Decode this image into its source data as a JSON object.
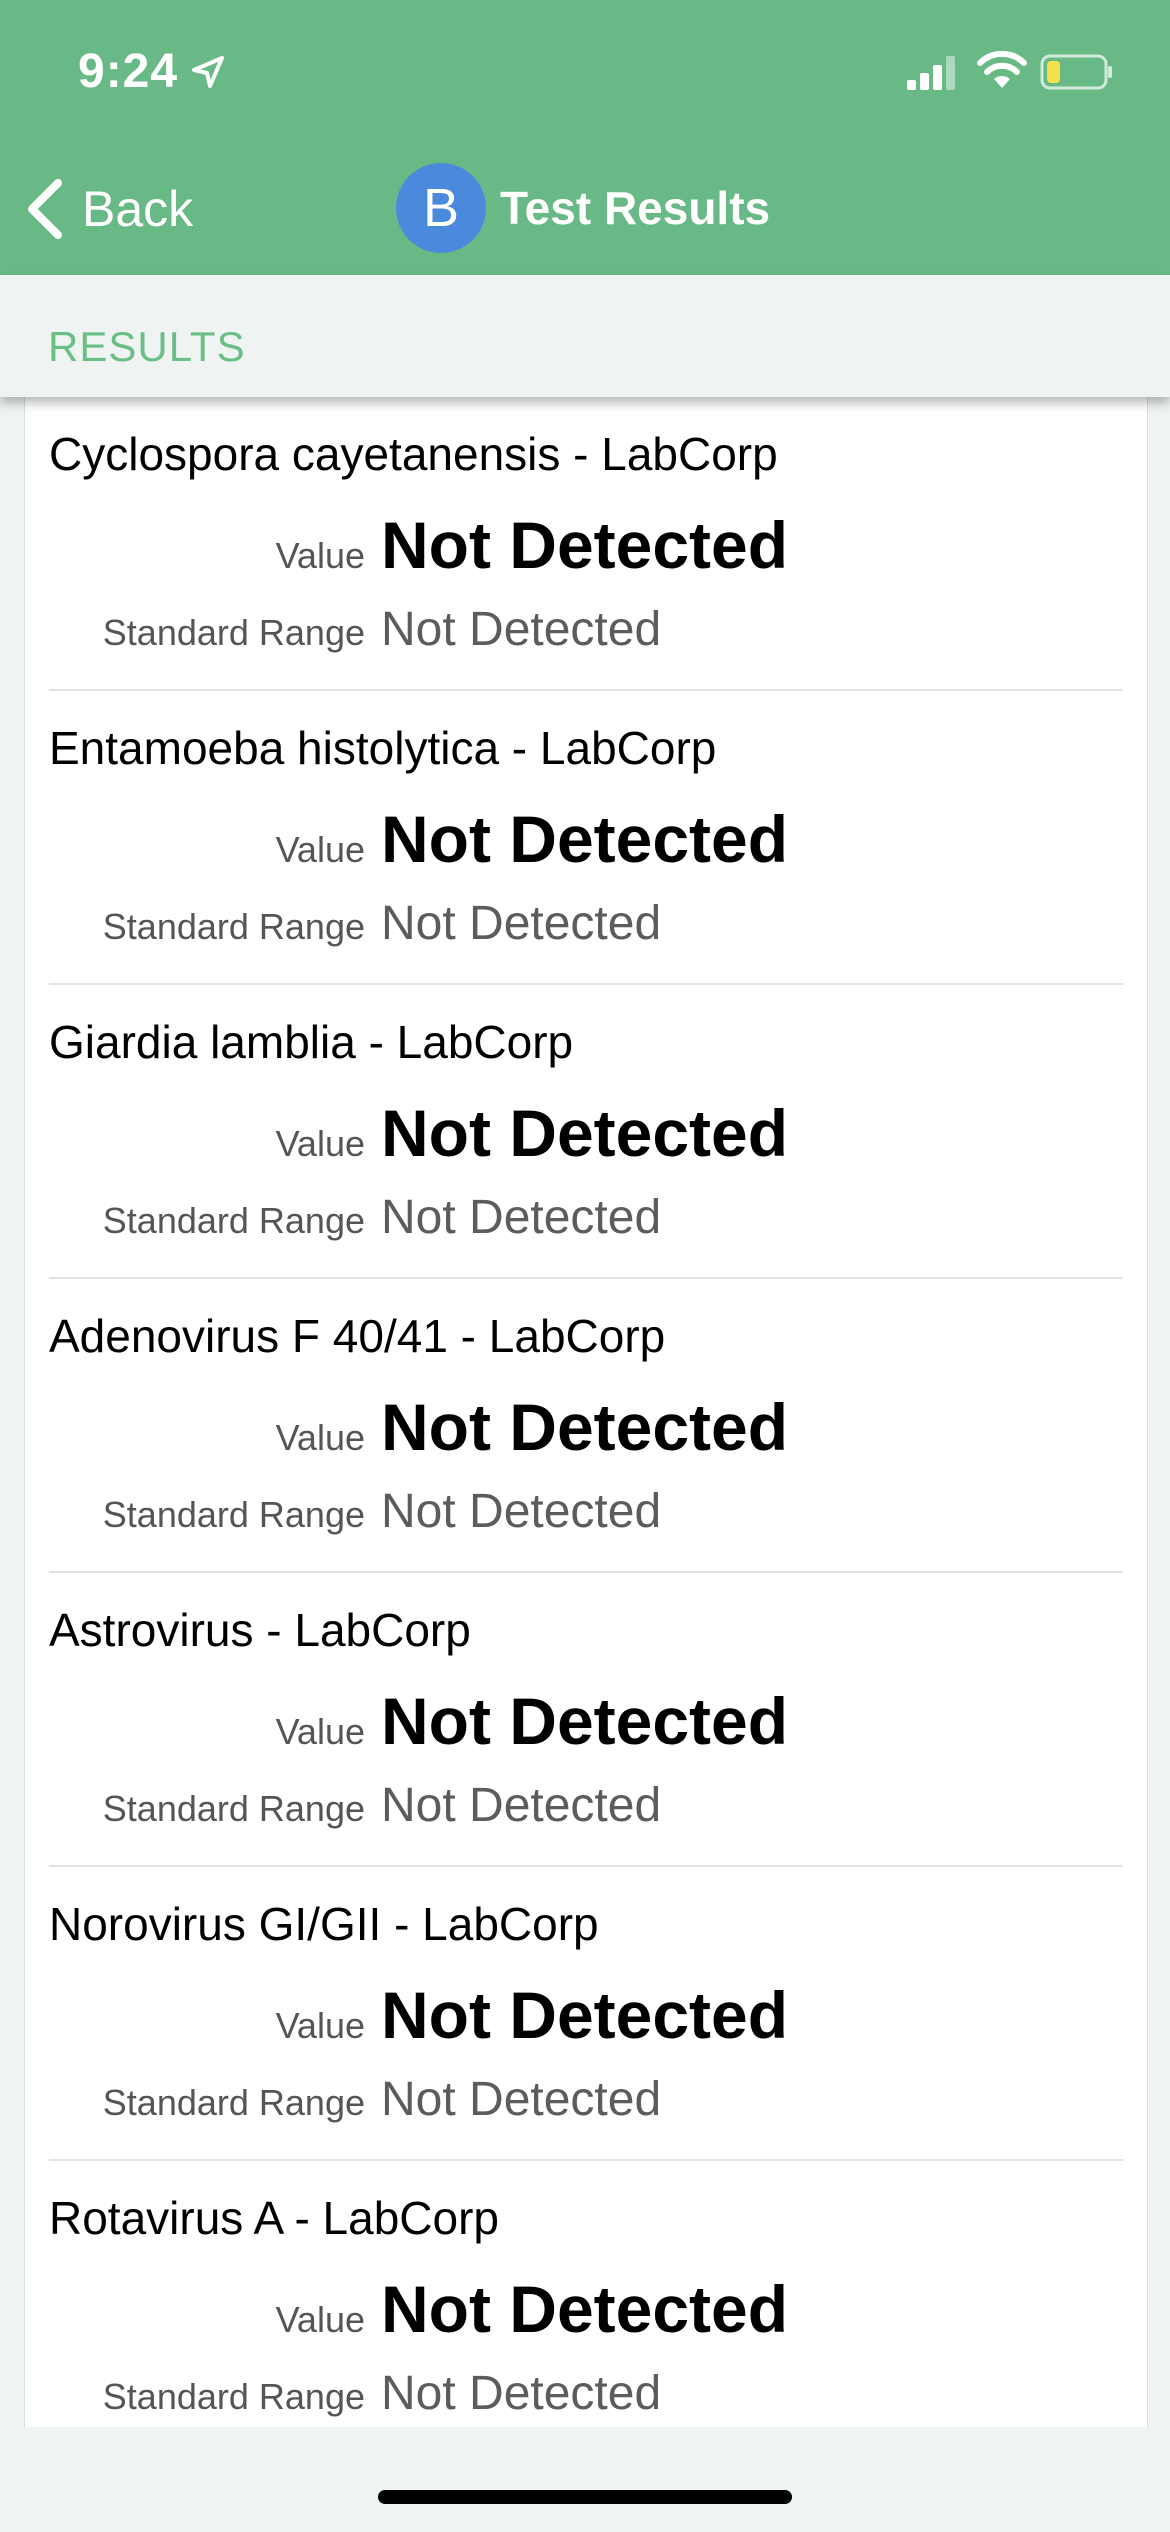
{
  "status_bar": {
    "time": "9:24"
  },
  "nav": {
    "back_label": "Back",
    "avatar_letter": "B",
    "title": "Test Results"
  },
  "section": {
    "title": "RESULTS"
  },
  "labels": {
    "value": "Value",
    "standard_range": "Standard Range"
  },
  "results": [
    {
      "name": "Cyclospora cayetanensis - LabCorp",
      "value": "Not Detected",
      "range": "Not Detected"
    },
    {
      "name": "Entamoeba histolytica - LabCorp",
      "value": "Not Detected",
      "range": "Not Detected"
    },
    {
      "name": "Giardia lamblia - LabCorp",
      "value": "Not Detected",
      "range": "Not Detected"
    },
    {
      "name": "Adenovirus F 40/41 - LabCorp",
      "value": "Not Detected",
      "range": "Not Detected"
    },
    {
      "name": "Astrovirus - LabCorp",
      "value": "Not Detected",
      "range": "Not Detected"
    },
    {
      "name": "Norovirus GI/GII - LabCorp",
      "value": "Not Detected",
      "range": "Not Detected"
    },
    {
      "name": "Rotavirus A - LabCorp",
      "value": "Not Detected",
      "range": "Not Detected"
    }
  ],
  "colors": {
    "header": "#68b985",
    "accent": "#6abf87",
    "avatar": "#4a89dc"
  },
  "icons": [
    "location-arrow-icon",
    "cellular-signal-icon",
    "wifi-icon",
    "battery-icon",
    "chevron-left-icon"
  ]
}
